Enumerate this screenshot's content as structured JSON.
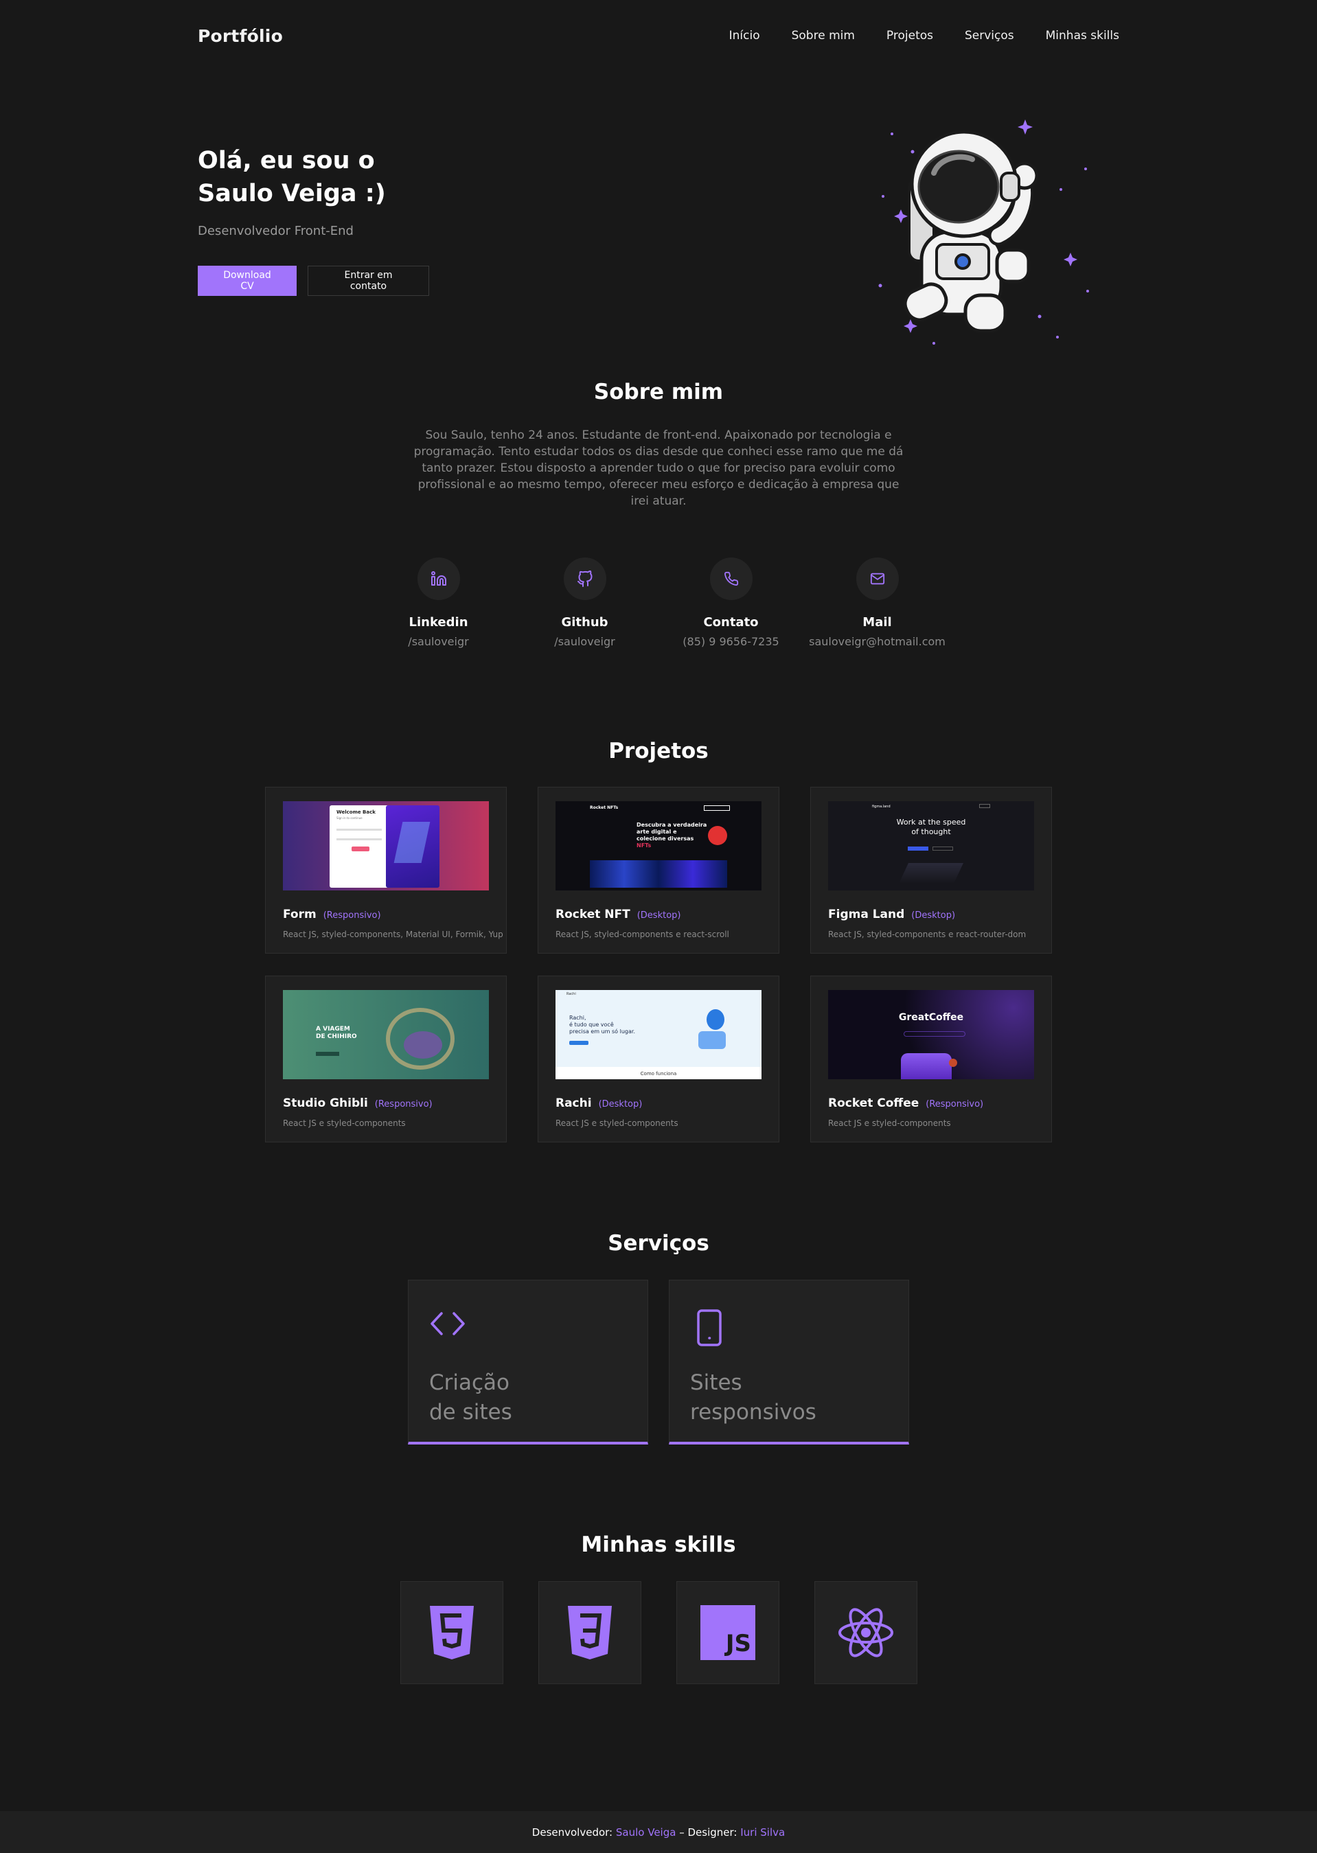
{
  "header": {
    "logo": "Portfólio",
    "nav": [
      "Início",
      "Sobre mim",
      "Projetos",
      "Serviços",
      "Minhas skills"
    ]
  },
  "hero": {
    "title_line1": "Olá, eu sou o",
    "title_line2": "Saulo Veiga :)",
    "subtitle": "Desenvolvedor Front-End",
    "primary_button": "Download CV",
    "secondary_button": "Entrar em contato"
  },
  "about": {
    "title": "Sobre mim",
    "text": "Sou Saulo, tenho 24 anos. Estudante de front-end. Apaixonado por tecnologia e programação. Tento estudar todos os dias desde que conheci esse ramo que me dá tanto prazer. Estou disposto a aprender tudo o que for preciso para evoluir como profissional e ao mesmo tempo, oferecer meu esforço e dedicação à empresa que irei atuar.",
    "contacts": [
      {
        "label": "Linkedin",
        "value": "/sauloveigr",
        "icon": "linkedin-icon"
      },
      {
        "label": "Github",
        "value": "/sauloveigr",
        "icon": "github-icon"
      },
      {
        "label": "Contato",
        "value": "(85) 9 9656-7235",
        "icon": "phone-icon"
      },
      {
        "label": "Mail",
        "value": "sauloveigr@hotmail.com",
        "icon": "mail-icon"
      }
    ]
  },
  "projects": {
    "title": "Projetos",
    "items": [
      {
        "name": "Form",
        "tag": "(Responsivo)",
        "desc": "React JS, styled-components, Material UI, Formik, Yup",
        "thumb_text": [
          "Welcome Back",
          "Sign in to continue"
        ]
      },
      {
        "name": "Rocket NFT",
        "tag": "(Desktop)",
        "desc": "React JS, styled-components e react-scroll",
        "thumb_text": [
          "Rocket NFTs",
          "Descubra a verdadeira",
          "arte digital e",
          "colecione diversas",
          "NFTs"
        ]
      },
      {
        "name": "Figma Land",
        "tag": "(Desktop)",
        "desc": "React JS, styled-components e react-router-dom",
        "thumb_text": [
          "figma.land",
          "Work at the speed",
          "of thought"
        ]
      },
      {
        "name": "Studio Ghibli",
        "tag": "(Responsivo)",
        "desc": "React JS e styled-components",
        "thumb_text": [
          "A VIAGEM",
          "DE CHIHIRO"
        ]
      },
      {
        "name": "Rachi",
        "tag": "(Desktop)",
        "desc": "React JS e styled-components",
        "thumb_text": [
          "Rachi",
          "Rachi,",
          "é tudo que você",
          "precisa em um só lugar.",
          "Como funciona"
        ]
      },
      {
        "name": "Rocket Coffee",
        "tag": "(Responsivo)",
        "desc": "React JS e styled-components",
        "thumb_text": [
          "GreatCoffee"
        ]
      }
    ]
  },
  "services": {
    "title": "Serviços",
    "items": [
      {
        "line1": "Criação",
        "line2": "de sites",
        "icon": "code-icon"
      },
      {
        "line1": "Sites",
        "line2": "responsivos",
        "icon": "mobile-icon"
      }
    ]
  },
  "skills": {
    "title": "Minhas skills",
    "items": [
      "html5-icon",
      "css3-icon",
      "javascript-icon",
      "react-icon"
    ],
    "js_label": "JS"
  },
  "footer": {
    "dev_prefix": "Desenvolvedor: ",
    "dev_name": "Saulo Veiga",
    "separator": " – Designer: ",
    "designer_name": "Iuri Silva"
  },
  "colors": {
    "background": "#181818",
    "card": "#202020",
    "accent": "#a174fb",
    "muted_text": "#8a8a8a"
  }
}
